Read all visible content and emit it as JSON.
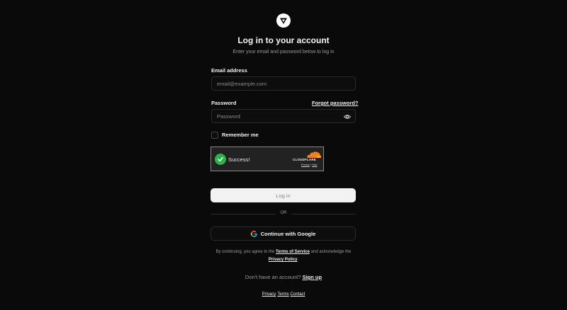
{
  "header": {
    "logo_icon": "triangle-logo-icon",
    "title": "Log in to your account",
    "subtitle": "Enter your email and password below to log in"
  },
  "form": {
    "email_label": "Email address",
    "email_placeholder": "email@example.com",
    "email_value": "",
    "password_label": "Password",
    "forgot_password": "Forgot password?",
    "password_placeholder": "Password",
    "password_value": "",
    "password_icon": "eye-icon",
    "remember_label": "Remember me",
    "remember_checked": false
  },
  "captcha": {
    "status_icon": "check-circle-icon",
    "status_text": "Success!",
    "brand": "CLOUDFLARE",
    "privacy_link": "Privacy",
    "separator": "•",
    "help_link": "Help",
    "accent_color": "#f38020",
    "success_color": "#2cb34a"
  },
  "actions": {
    "login_label": "Log in",
    "or_label": "OR",
    "google_icon": "google-icon",
    "google_label": "Continue with Google"
  },
  "legal": {
    "prefix": "By continuing, you agree to the",
    "terms_link": "Terms of Service",
    "middle": "and acknowledge the",
    "privacy_link": "Privacy Policy",
    "suffix": "."
  },
  "signup": {
    "prompt": "Don't have an account?",
    "link": "Sign up"
  },
  "footer": {
    "privacy": "Privacy",
    "sep1": "·",
    "terms": "Terms",
    "sep2": "·",
    "contact": "Contact"
  }
}
